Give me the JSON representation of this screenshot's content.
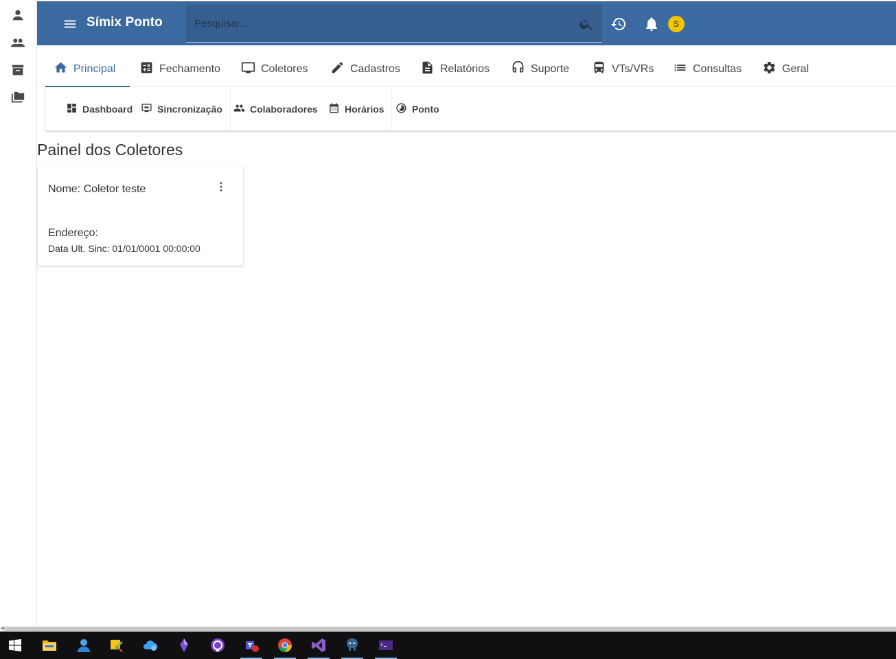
{
  "rail": {
    "items": [
      {
        "icon": "person-icon"
      },
      {
        "icon": "group-icon"
      },
      {
        "icon": "archive-icon"
      },
      {
        "icon": "folders-icon"
      }
    ]
  },
  "header": {
    "title": "Símix Ponto",
    "search_placeholder": "Pesquisar...",
    "avatar_initial": "S",
    "primary_color": "#3b6aa0"
  },
  "tabs": [
    {
      "label": "Principal",
      "icon": "home-icon",
      "active": true
    },
    {
      "label": "Fechamento",
      "icon": "calculator-icon"
    },
    {
      "label": "Coletores",
      "icon": "monitor-icon"
    },
    {
      "label": "Cadastros",
      "icon": "pencil-icon"
    },
    {
      "label": "Relatórios",
      "icon": "document-icon"
    },
    {
      "label": "Suporte",
      "icon": "headset-icon"
    },
    {
      "label": "VTs/VRs",
      "icon": "bus-icon"
    },
    {
      "label": "Consultas",
      "icon": "list-icon"
    },
    {
      "label": "Geral",
      "icon": "gear-icon"
    }
  ],
  "subnav": [
    {
      "label": "Dashboard",
      "icon": "dashboard-icon"
    },
    {
      "label": "Sincronização",
      "icon": "sync-screen-icon"
    },
    {
      "label": "Colaboradores",
      "icon": "people-icon"
    },
    {
      "label": "Horários",
      "icon": "calendar-icon"
    },
    {
      "label": "Ponto",
      "icon": "clock-circle-icon"
    }
  ],
  "page": {
    "title": "Painel dos Coletores"
  },
  "card": {
    "name": "Nome: Coletor teste",
    "address": "Endereço:",
    "last_sync": "Data Ult. Sinc: 01/01/0001 00:00:00"
  },
  "taskbar": {
    "items": [
      {
        "icon": "windows-start-icon"
      },
      {
        "icon": "file-explorer-icon"
      },
      {
        "icon": "user-app-icon"
      },
      {
        "icon": "sticky-tools-icon"
      },
      {
        "icon": "cloud-app-icon"
      },
      {
        "icon": "crystal-app-icon"
      },
      {
        "icon": "github-icon"
      },
      {
        "icon": "teams-icon"
      },
      {
        "icon": "chrome-icon"
      },
      {
        "icon": "visual-studio-icon"
      },
      {
        "icon": "postgres-icon"
      },
      {
        "icon": "terminal-icon"
      }
    ]
  }
}
